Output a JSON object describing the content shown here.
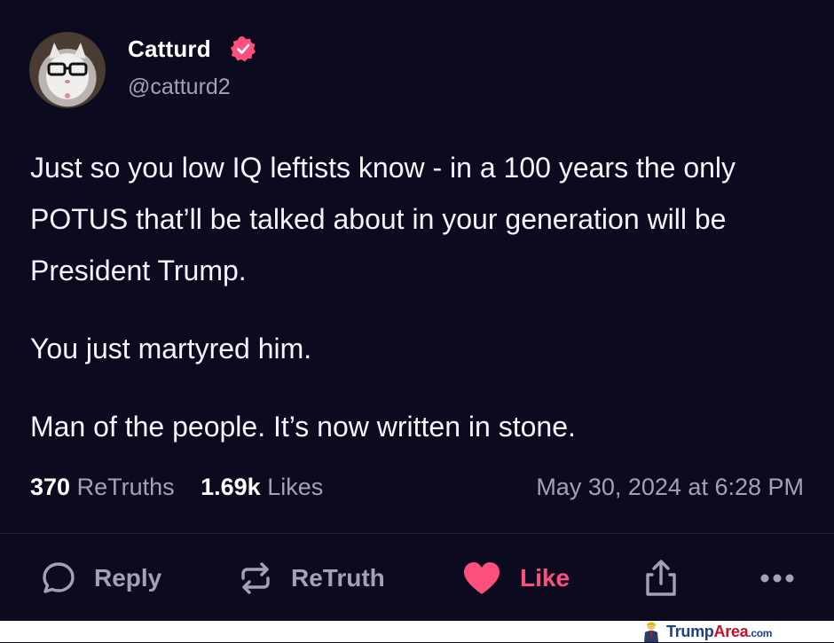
{
  "author": {
    "name": "Catturd",
    "handle": "@catturd2",
    "verified": true
  },
  "post": {
    "paragraphs": [
      "Just so you low IQ leftists know - in a 100 years the only POTUS that’ll be talked about in your generation will be President Trump.",
      "You just martyred him.",
      "Man of the people. It’s now written in stone."
    ],
    "retruths_count": "370",
    "retruths_label": "ReTruths",
    "likes_count": "1.69k",
    "likes_label": "Likes",
    "timestamp": "May 30, 2024 at 6:28 PM"
  },
  "actions": {
    "reply": "Reply",
    "retruth": "ReTruth",
    "like": "Like"
  },
  "watermark": "TrumpArea.com",
  "colors": {
    "background": "#0c0a1e",
    "muted_text": "#a4a1b3",
    "like_accent": "#ff4f7e",
    "verified_badge": "#ff4f7e"
  },
  "icons": [
    "verified-badge-icon",
    "reply-icon",
    "retruth-icon",
    "heart-icon",
    "share-icon",
    "more-icon"
  ]
}
